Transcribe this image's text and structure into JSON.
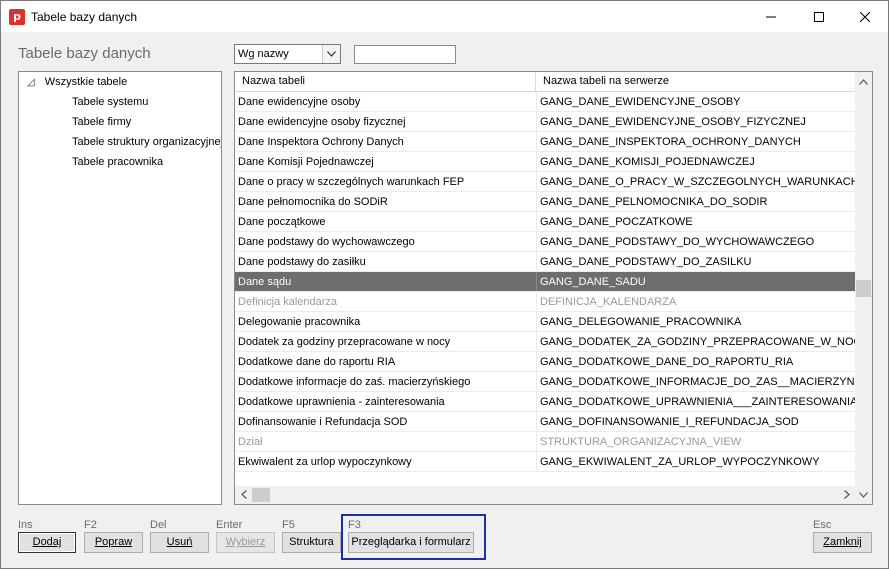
{
  "window": {
    "title": "Tabele bazy danych",
    "app_icon_letter": "p"
  },
  "page_title": "Tabele bazy danych",
  "filter": {
    "selected": "Wg nazwy",
    "search_value": ""
  },
  "tree": {
    "root": "Wszystkie tabele",
    "children": [
      "Tabele systemu",
      "Tabele firmy",
      "Tabele struktury organizacyjnej",
      "Tabele pracownika"
    ]
  },
  "grid": {
    "columns": [
      "Nazwa tabeli",
      "Nazwa tabeli na serwerze"
    ],
    "rows": [
      {
        "name": "Dane ewidencyjne osoby",
        "server": "GANG_DANE_EWIDENCYJNE_OSOBY",
        "state": "normal"
      },
      {
        "name": "Dane ewidencyjne osoby fizycznej",
        "server": "GANG_DANE_EWIDENCYJNE_OSOBY_FIZYCZNEJ",
        "state": "normal"
      },
      {
        "name": "Dane Inspektora Ochrony Danych",
        "server": "GANG_DANE_INSPEKTORA_OCHRONY_DANYCH",
        "state": "normal"
      },
      {
        "name": "Dane Komisji Pojednawczej",
        "server": "GANG_DANE_KOMISJI_POJEDNAWCZEJ",
        "state": "normal"
      },
      {
        "name": "Dane o pracy w szczególnych warunkach FEP",
        "server": "GANG_DANE_O_PRACY_W_SZCZEGOLNYCH_WARUNKACH_FEP",
        "state": "normal"
      },
      {
        "name": "Dane pełnomocnika do SODiR",
        "server": "GANG_DANE_PELNOMOCNIKA_DO_SODIR",
        "state": "normal"
      },
      {
        "name": "Dane początkowe",
        "server": "GANG_DANE_POCZATKOWE",
        "state": "normal"
      },
      {
        "name": "Dane podstawy do wychowawczego",
        "server": "GANG_DANE_PODSTAWY_DO_WYCHOWAWCZEGO",
        "state": "normal"
      },
      {
        "name": "Dane podstawy do zasiłku",
        "server": "GANG_DANE_PODSTAWY_DO_ZASILKU",
        "state": "normal"
      },
      {
        "name": "Dane sądu",
        "server": "GANG_DANE_SADU",
        "state": "selected"
      },
      {
        "name": "Definicja kalendarza",
        "server": "DEFINICJA_KALENDARZA",
        "state": "disabled"
      },
      {
        "name": "Delegowanie pracownika",
        "server": "GANG_DELEGOWANIE_PRACOWNIKA",
        "state": "normal"
      },
      {
        "name": "Dodatek za godziny przepracowane w nocy",
        "server": "GANG_DODATEK_ZA_GODZINY_PRZEPRACOWANE_W_NOCY",
        "state": "normal"
      },
      {
        "name": "Dodatkowe dane do raportu RIA",
        "server": "GANG_DODATKOWE_DANE_DO_RAPORTU_RIA",
        "state": "normal"
      },
      {
        "name": "Dodatkowe informacje do zaś. macierzyńskiego",
        "server": "GANG_DODATKOWE_INFORMACJE_DO_ZAS__MACIERZYNSKIEGO",
        "state": "normal"
      },
      {
        "name": "Dodatkowe uprawnienia - zainteresowania",
        "server": "GANG_DODATKOWE_UPRAWNIENIA___ZAINTERESOWANIA",
        "state": "normal"
      },
      {
        "name": "Dofinansowanie i Refundacja SOD",
        "server": "GANG_DOFINANSOWANIE_I_REFUNDACJA_SOD",
        "state": "normal"
      },
      {
        "name": "Dział",
        "server": "STRUKTURA_ORGANIZACYJNA_VIEW",
        "state": "disabled"
      },
      {
        "name": "Ekwiwalent za urlop wypoczynkowy",
        "server": "GANG_EKWIWALENT_ZA_URLOP_WYPOCZYNKOWY",
        "state": "normal"
      }
    ]
  },
  "actions": {
    "dodaj": {
      "key": "Ins",
      "label": "Dodaj"
    },
    "popraw": {
      "key": "F2",
      "label": "Popraw"
    },
    "usun": {
      "key": "Del",
      "label": "Usuń"
    },
    "wybierz": {
      "key": "Enter",
      "label": "Wybierz"
    },
    "struktura": {
      "key": "F5",
      "label": "Struktura"
    },
    "przegladarka": {
      "key": "F3",
      "label": "Przeglądarka i formularz"
    },
    "zamknij": {
      "key": "Esc",
      "label": "Zamknij"
    }
  },
  "colors": {
    "selection": "#6d6d6d",
    "focus_frame": "#1a2fa8",
    "app_icon": "#d9312b"
  }
}
